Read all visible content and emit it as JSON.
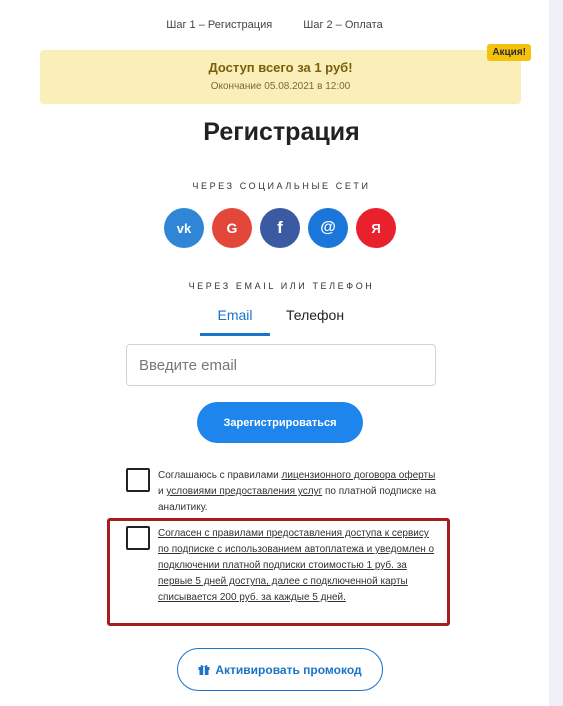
{
  "steps": [
    "Шаг 1 – Регистрация",
    "Шаг 2 – Оплата"
  ],
  "promo": {
    "title": "Доступ всего за 1 руб!",
    "ends": "Окончание 05.08.2021 в 12:00",
    "badge": "Акция!"
  },
  "title": "Регистрация",
  "social_label": "ЧЕРЕЗ СОЦИАЛЬНЫЕ СЕТИ",
  "social": [
    {
      "icon": "vk-icon",
      "glyph": "vk",
      "color": "#2f86d7"
    },
    {
      "icon": "google-icon",
      "glyph": "G",
      "color": "#e2473a"
    },
    {
      "icon": "facebook-icon",
      "glyph": "f",
      "color": "#3b5aa1"
    },
    {
      "icon": "mail-icon",
      "glyph": "@",
      "color": "#1a76d8"
    },
    {
      "icon": "yandex-icon",
      "glyph": "Я",
      "color": "#e8212c"
    }
  ],
  "contact_label": "ЧЕРЕЗ EMAIL ИЛИ ТЕЛЕФОН",
  "tabs": [
    {
      "label": "Email",
      "active": true
    },
    {
      "label": "Телефон",
      "active": false
    }
  ],
  "email": {
    "value": "",
    "placeholder": "Введите email"
  },
  "register_button": "Зарегистрироваться",
  "agreement1": {
    "part1": "Соглашаюсь с правилами ",
    "link1": "лицензионного договора оферты",
    "part2": " и ",
    "link2": "условиями предоставления услуг",
    "part3": " по платной подписке на аналитику."
  },
  "agreement2": {
    "text": "Согласен с правилами предоставления доступа к сервису по подписке с использованием автоплатежа и уведомлен о подключении платной подписки стоимостью 1 руб. за первые 5 дней доступа, далее с подключенной карты списывается 200 руб. за каждые 5 дней."
  },
  "promo_button": "Активировать промокод",
  "colors": {
    "accent": "#1e85ec",
    "promo_bg": "#fbefb9",
    "badge": "#f4c20d",
    "highlight_border": "#a71c1c"
  }
}
